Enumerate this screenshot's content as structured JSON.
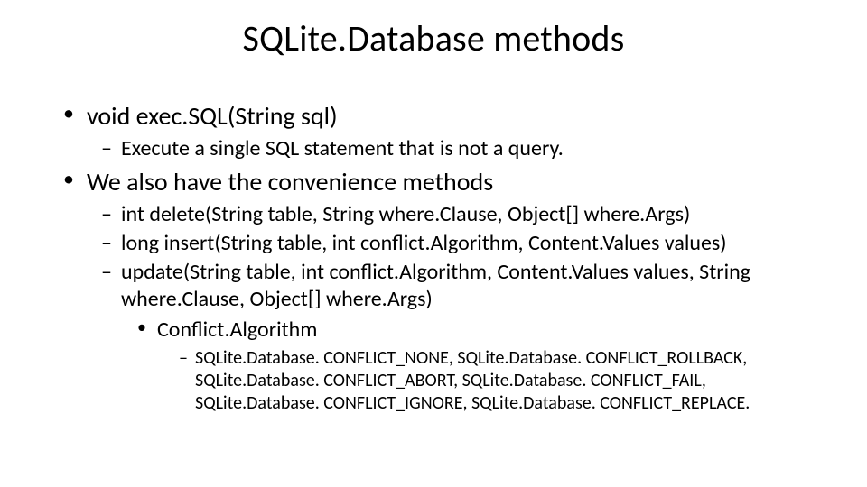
{
  "title": "SQLite.Database methods",
  "bullets": {
    "b1": "void exec.SQL(String sql)",
    "b1_1": "Execute a single SQL statement that is not a query.",
    "b2": "We also have the convenience methods",
    "b2_1": "int delete(String table, String where.Clause, Object[] where.Args)",
    "b2_2": "long insert(String table, int conflict.Algorithm, Content.Values values)",
    "b2_3": "update(String table, int conflict.Algorithm, Content.Values values, String where.Clause, Object[] where.Args)",
    "b2_3_1": "Conflict.Algorithm",
    "b2_3_1_1": "SQLite.Database. CONFLICT_NONE, SQLite.Database. CONFLICT_ROLLBACK, SQLite.Database. CONFLICT_ABORT, SQLite.Database. CONFLICT_FAIL, SQLite.Database. CONFLICT_IGNORE, SQLite.Database. CONFLICT_REPLACE."
  }
}
